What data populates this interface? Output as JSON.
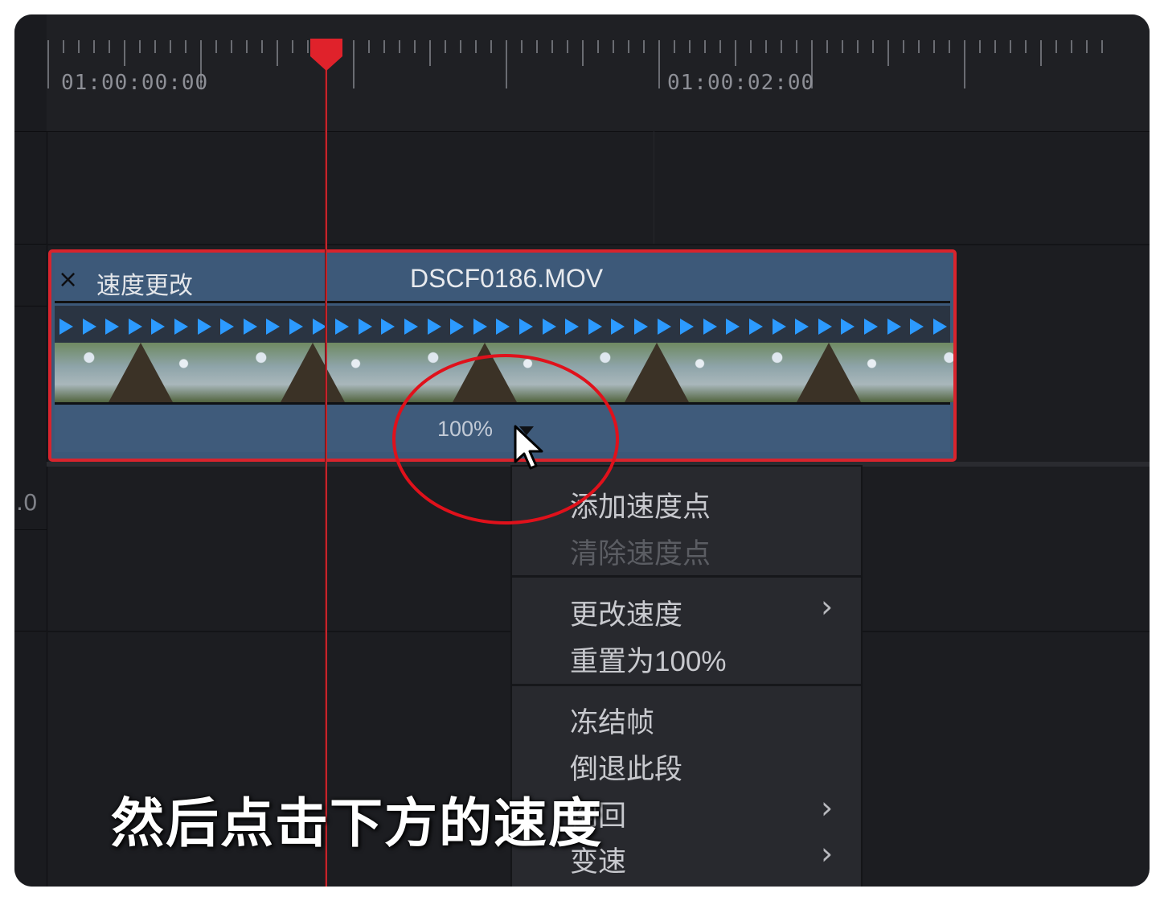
{
  "ruler": {
    "timecodes": [
      "01:00:00:00",
      "01:00:02:00"
    ]
  },
  "clip": {
    "close_icon": "×",
    "effect_label": "速度更改",
    "name": "DSCF0186.MOV",
    "speed_value": "100%"
  },
  "track": {
    "left_label": ".0"
  },
  "context_menu": {
    "items": [
      {
        "label": "添加速度点",
        "enabled": true
      },
      {
        "label": "清除速度点",
        "enabled": false
      },
      {
        "label": "更改速度",
        "enabled": true,
        "submenu": true
      },
      {
        "label": "重置为100%",
        "enabled": true
      },
      {
        "label": "冻结帧",
        "enabled": true
      },
      {
        "label": "倒退此段",
        "enabled": true
      },
      {
        "label": "倒回",
        "enabled": true,
        "submenu": true
      },
      {
        "label": "变速",
        "enabled": true,
        "submenu": true
      }
    ],
    "submenu_arrow": "›"
  },
  "caption": "然后点击下方的速度",
  "colors": {
    "playhead": "#d8242d",
    "annotation": "#e0111b",
    "clip_blue": "#3d5979",
    "speed_arrow": "#2c9aff"
  }
}
